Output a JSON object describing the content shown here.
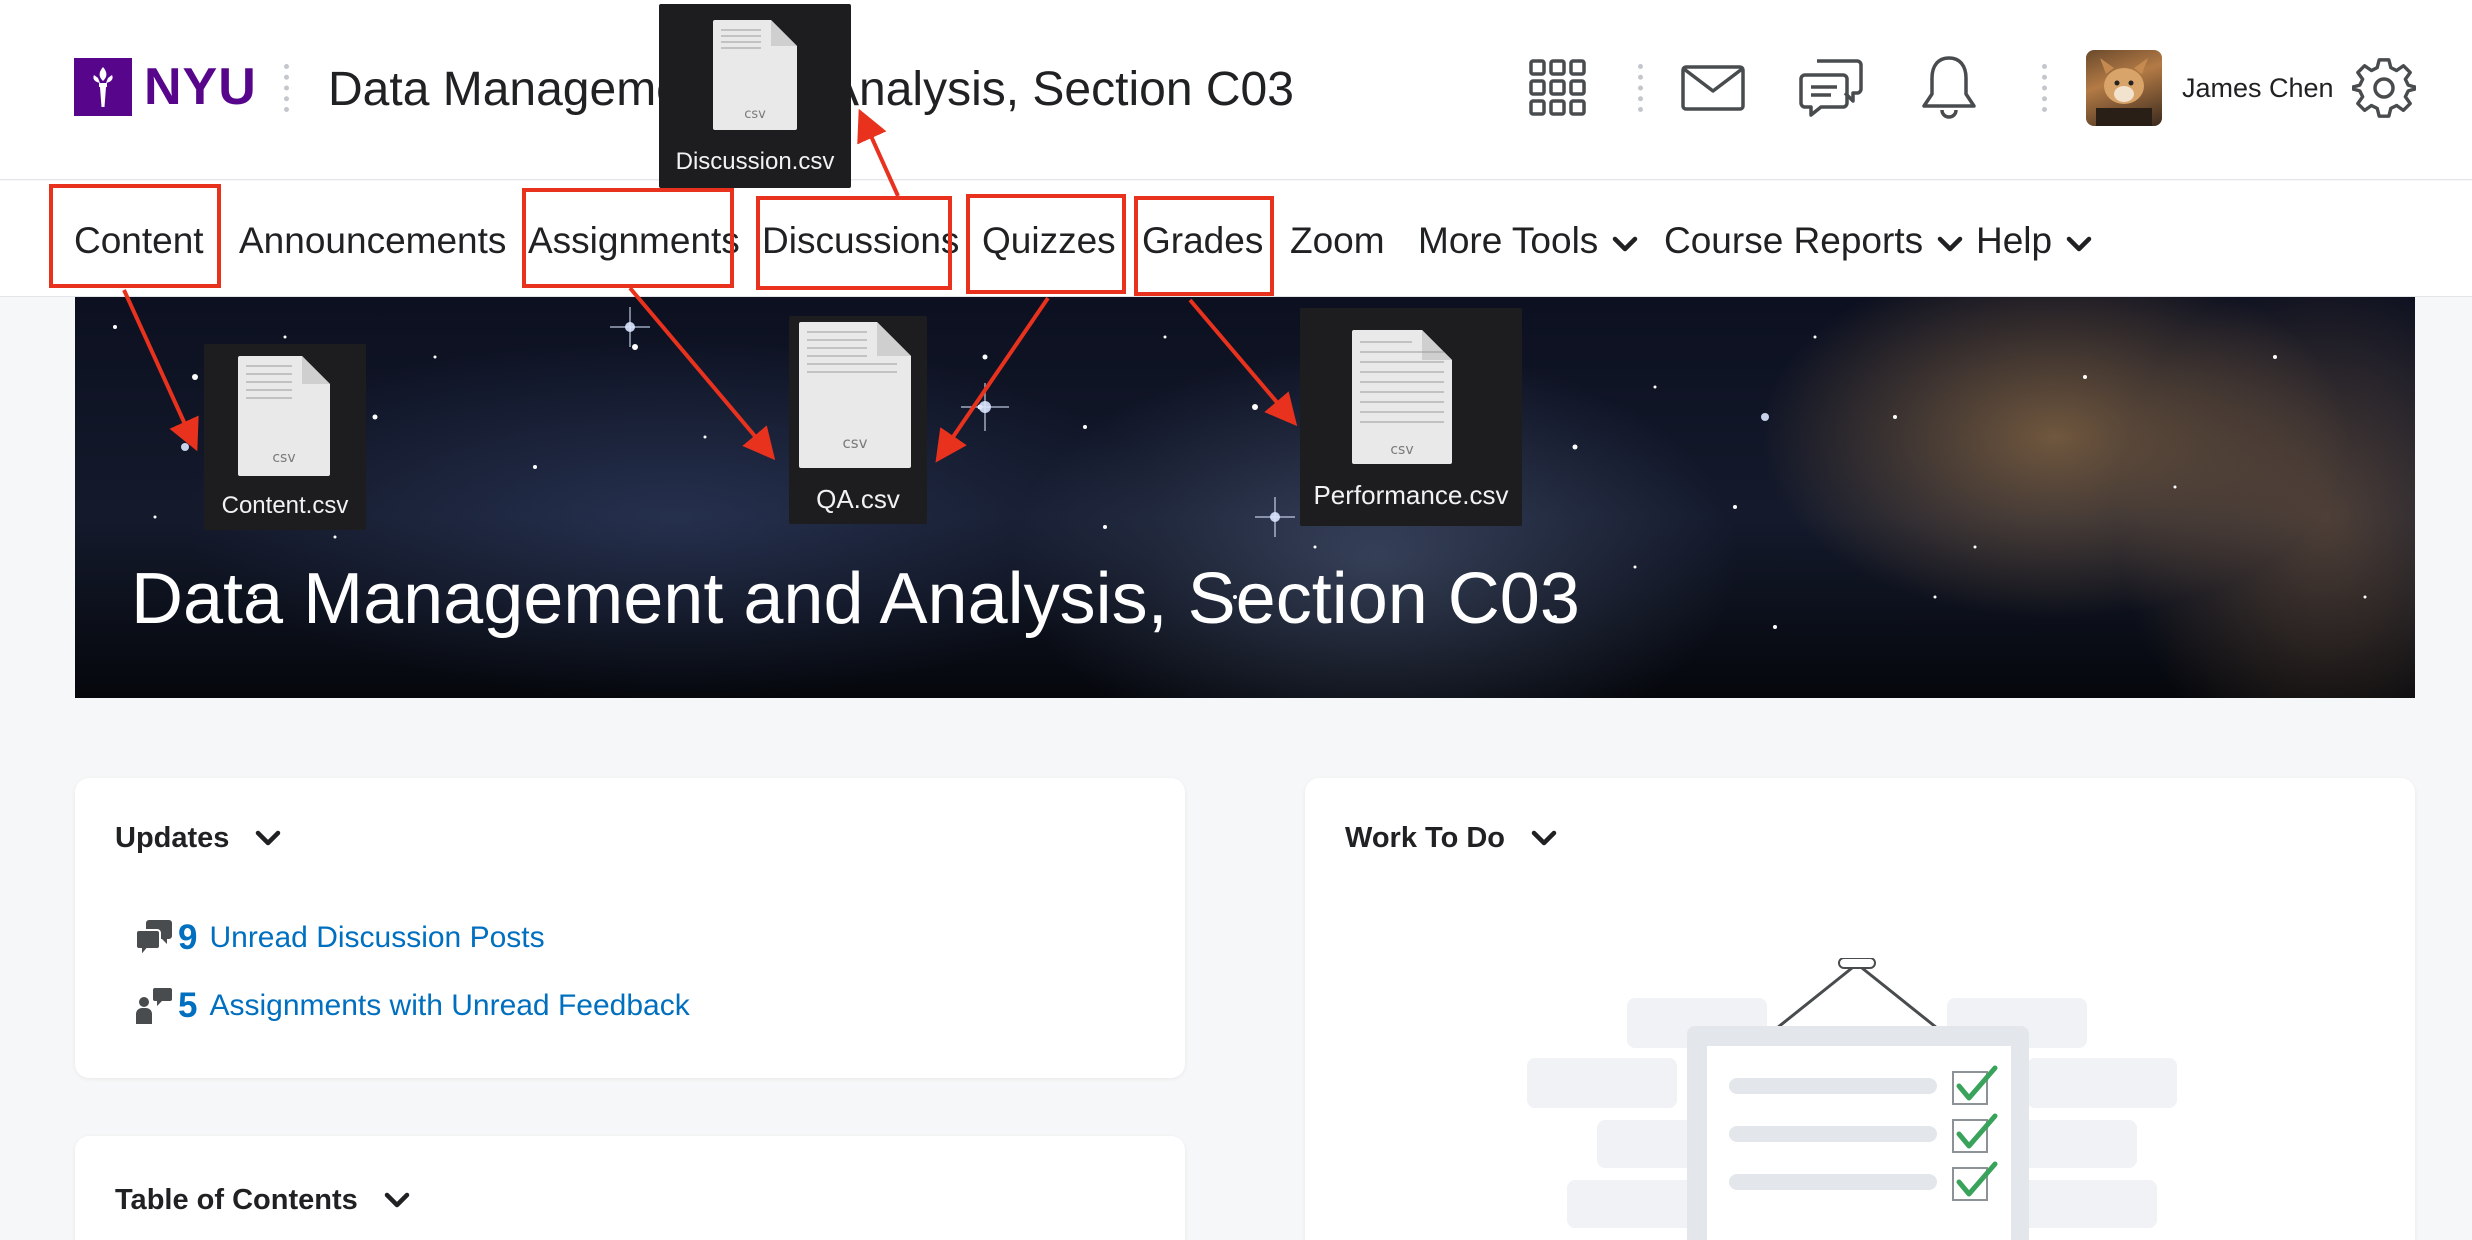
{
  "header": {
    "logo_text": "NYU",
    "course_title": "Data Management and Analysis, Section C03",
    "user_name": "James Chen",
    "icons": [
      "waffle-icon",
      "email-icon",
      "chat-icon",
      "bell-icon",
      "gear-icon"
    ]
  },
  "nav": {
    "items": [
      {
        "label": "Content"
      },
      {
        "label": "Announcements"
      },
      {
        "label": "Assignments"
      },
      {
        "label": "Discussions"
      },
      {
        "label": "Quizzes"
      },
      {
        "label": "Grades"
      },
      {
        "label": "Zoom"
      },
      {
        "label": "More Tools"
      },
      {
        "label": "Course Reports"
      },
      {
        "label": "Help"
      }
    ]
  },
  "banner": {
    "title": "Data Management and Analysis, Section C03"
  },
  "files": {
    "discussion": {
      "name": "Discussion.csv",
      "ext": "csv"
    },
    "content": {
      "name": "Content.csv",
      "ext": "csv"
    },
    "qa": {
      "name": "QA.csv",
      "ext": "csv"
    },
    "performance": {
      "name": "Performance.csv",
      "ext": "csv"
    }
  },
  "updates": {
    "title": "Updates",
    "items": [
      {
        "count": "9",
        "label": "Unread Discussion Posts"
      },
      {
        "count": "5",
        "label": "Assignments with Unread Feedback"
      }
    ]
  },
  "work_to_do": {
    "title": "Work To Do"
  },
  "toc": {
    "title": "Table of Contents"
  },
  "colors": {
    "brand": "#57068c",
    "link": "#006fbf",
    "annotation": "#e8321e"
  }
}
